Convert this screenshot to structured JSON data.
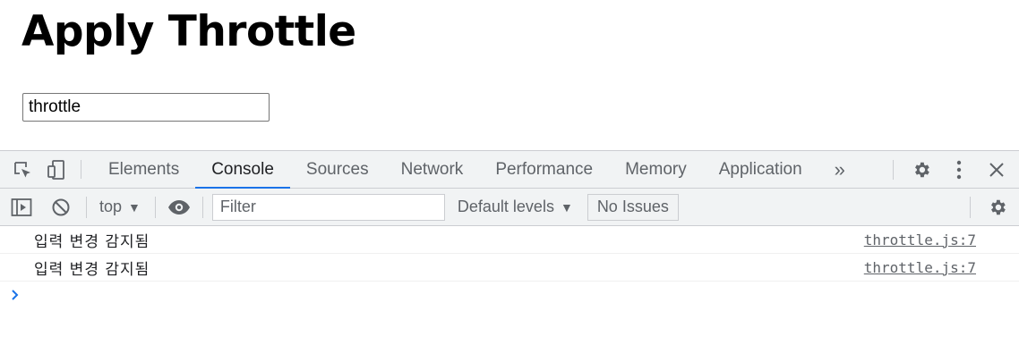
{
  "page": {
    "title": "Apply Throttle",
    "input_value": "throttle"
  },
  "devtools": {
    "tabs": [
      {
        "label": "Elements",
        "active": false
      },
      {
        "label": "Console",
        "active": true
      },
      {
        "label": "Sources",
        "active": false
      },
      {
        "label": "Network",
        "active": false
      },
      {
        "label": "Performance",
        "active": false
      },
      {
        "label": "Memory",
        "active": false
      },
      {
        "label": "Application",
        "active": false
      }
    ],
    "more_tabs_glyph": "»",
    "toolbar": {
      "context": "top",
      "filter_placeholder": "Filter",
      "levels_label": "Default levels",
      "issues_label": "No Issues"
    },
    "logs": [
      {
        "message": "입력 변경 감지됨",
        "source": "throttle.js:7"
      },
      {
        "message": "입력 변경 감지됨",
        "source": "throttle.js:7"
      }
    ],
    "colors": {
      "accent": "#1a73e8",
      "toolbar_bg": "#f1f3f4",
      "icon": "#5f6368"
    }
  }
}
